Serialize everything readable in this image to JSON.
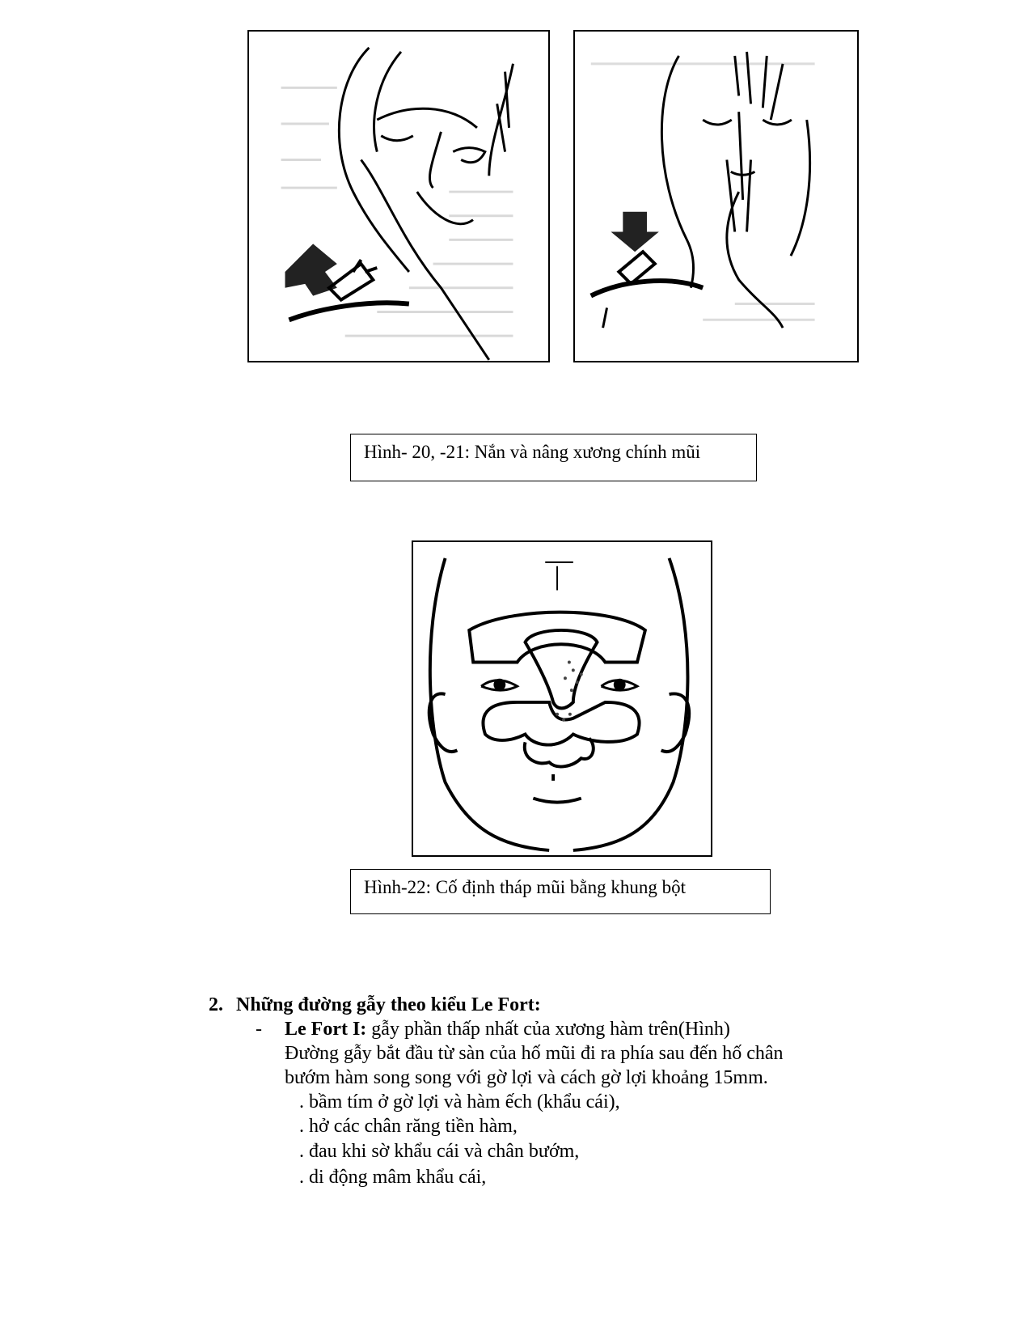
{
  "figures": [
    {
      "name": "Hình-20 illustration"
    },
    {
      "name": "Hình-21 illustration"
    },
    {
      "name": "Hình-22 illustration"
    }
  ],
  "captions": {
    "fig20_21": "Hình- 20, -21: Nắn và nâng xương chính mũi",
    "fig22": "Hình-22: Cố  định tháp mũi bằng khung bột"
  },
  "section": {
    "number": "2.",
    "heading": "Những đường gẫy theo kiểu Le Fort:",
    "bullet": {
      "marker": "-",
      "term": "Le Fort I:",
      "text": " gẫy phần thấp nhất của xương hàm trên(Hình)",
      "lines": [
        "Đường gẫy bắt đầu từ sàn của hố mũi đi ra phía sau đến hố chân",
        "bướm hàm song song với gờ lợi và cách gờ lợi khoảng 15mm."
      ],
      "signs": [
        ". bầm tím ở gờ lợi và hàm ếch (khẩu cái),",
        ". hở các chân răng tiền hàm,",
        ". đau khi sờ khẩu cái và chân bướm,",
        ". di động mâm khẩu cái,"
      ]
    }
  }
}
